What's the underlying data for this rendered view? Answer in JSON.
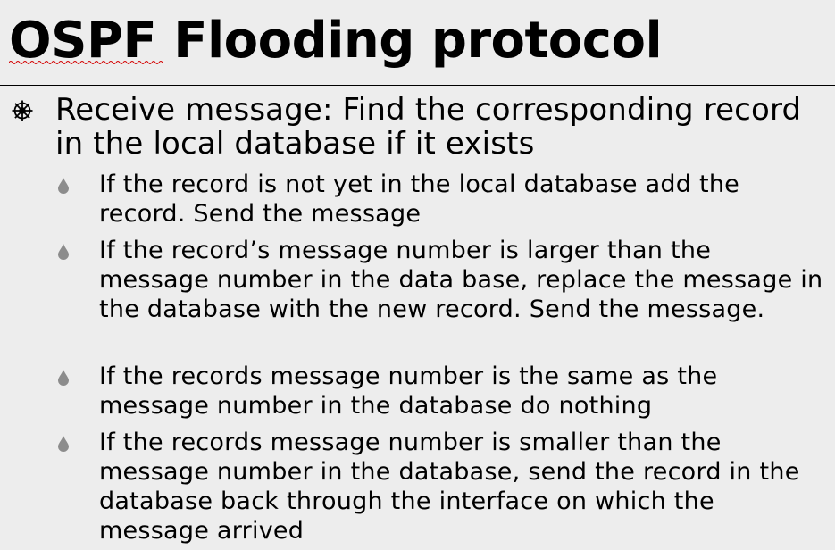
{
  "slide": {
    "title": "OSPF Flooding protocol",
    "main_point": "Receive message: Find the corresponding record in the local database if it exists",
    "sub_points": [
      "If the record is not yet in the local database add the record. Send the message",
      "If the record’s message number is larger than the message number in the data base, replace the message in the database with the new record. Send the message.",
      "If the records message number is the same as the message number in the database do nothing",
      "If the records message number is smaller than the message number in the database, send the record in the database back through the interface on which the message arrived"
    ]
  },
  "icons": {
    "level1_bullet": "wheel-bullet-icon",
    "level2_bullet": "drop-bullet-icon"
  },
  "colors": {
    "background": "#ededed",
    "text": "#000000",
    "sub_bullet": "#8c8c8c",
    "spellcheck_underline": "#d40000"
  }
}
